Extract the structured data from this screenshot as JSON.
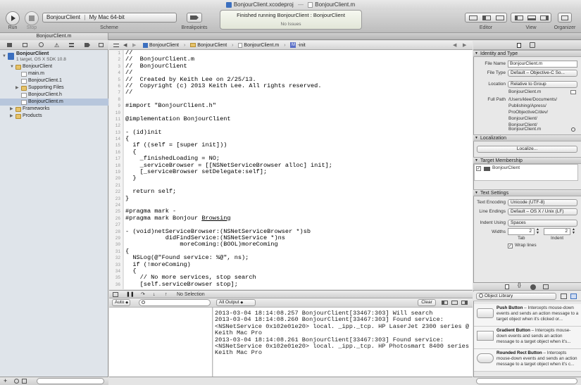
{
  "window": {
    "tabs": [
      "BonjourClient.xcodeproj",
      "BonjourClient.m"
    ]
  },
  "toolbar": {
    "run_label": "Run",
    "stop_label": "Stop",
    "scheme_target": "BonjourClient",
    "scheme_destination": "My Mac 64-bit",
    "scheme_label": "Scheme",
    "breakpoints_label": "Breakpoints",
    "activity_status": "Finished running BonjourClient : BonjourClient",
    "activity_issues": "No Issues",
    "editor_label": "Editor",
    "view_label": "View",
    "organizer_label": "Organizer"
  },
  "tab_title": "BonjourClient.m",
  "navigator": {
    "project_name": "BonjourClient",
    "project_sub": "1 target, OS X SDK 10.8",
    "items": [
      {
        "label": "BonjourClient"
      },
      {
        "label": "main.m"
      },
      {
        "label": "BonjourClient.1"
      },
      {
        "label": "Supporting Files"
      },
      {
        "label": "BonjourClient.h"
      },
      {
        "label": "BonjourClient.m"
      },
      {
        "label": "Frameworks"
      },
      {
        "label": "Products"
      }
    ]
  },
  "jumpbar": {
    "crumbs": [
      "BonjourClient",
      "BonjourClient",
      "BonjourClient.m",
      "-init"
    ]
  },
  "code": {
    "lines": [
      "//",
      "//  BonjourClient.m",
      "//  BonjourClient",
      "//",
      "//  Created by Keith Lee on 2/25/13.",
      "//  Copyright (c) 2013 Keith Lee. All rights reserved.",
      "//",
      "",
      "#import \"BonjourClient.h\"",
      "",
      "@implementation BonjourClient",
      "",
      "- (id)init",
      "{",
      "  if ((self = [super init]))",
      "  {",
      "    _finishedLoading = NO;",
      "    _serviceBrowser = [[NSNetServiceBrowser alloc] init];",
      "    [_serviceBrowser setDelegate:self];",
      "  }",
      "",
      "  return self;",
      "}",
      "",
      "#pragma mark -",
      "#pragma mark Bonjour ",
      "",
      "- (void)netServiceBrowser:(NSNetServiceBrowser *)sb",
      "           didFindService:(NSNetService *)ns",
      "               moreComing:(BOOL)moreComing",
      "{",
      "  NSLog(@\"Found service: %@\", ns);",
      "  if (!moreComing)",
      "  {",
      "    // No more services, stop search",
      "    [self.serviceBrowser stop];"
    ],
    "underlined_word": "Browsing",
    "line_numbers": [
      "1",
      "2",
      "3",
      "4",
      "5",
      "6",
      "7",
      "8",
      "9",
      "10",
      "11",
      "12",
      "13",
      "14",
      "15",
      "16",
      "17",
      "18",
      "19",
      "20",
      "21",
      "22",
      "23",
      "24",
      "25",
      "26",
      "27",
      "28",
      "29",
      "30",
      "31",
      "32",
      "33",
      "34",
      "35",
      "36"
    ]
  },
  "debug": {
    "selection": "No Selection",
    "auto_label": "Auto",
    "all_output_label": "All Output",
    "clear_label": "Clear",
    "console_lines": [
      "2013-03-04 18:14:08.257 BonjourClient[33467:303] Will search",
      "2013-03-04 18:14:08.260 BonjourClient[33467:303] Found service:",
      "<NSNetService 0x102e01e20> local. _ipp._tcp. HP LaserJet 2300 series @",
      "Keith Mac Pro",
      "2013-03-04 18:14:08.261 BonjourClient[33467:303] Found service:",
      "<NSNetService 0x102e01e20> local. _ipp._tcp. HP Photosmart 8400 series @",
      "Keith Mac Pro"
    ]
  },
  "inspector": {
    "identity_header": "Identity and Type",
    "file_name_label": "File Name",
    "file_name": "BonjourClient.m",
    "file_type_label": "File Type",
    "file_type": "Default – Objective-C So...",
    "location_label": "Location",
    "location": "Relative to Group",
    "location_file": "BonjourClient.m",
    "full_path_label": "Full Path",
    "full_path": [
      "/Users/klee/Documents/",
      "Publishing/Apress/",
      "ProObjectiveC/dev/",
      "BonjourClient/",
      "BonjourClient/",
      "BonjourClient.m"
    ],
    "localization_header": "Localization",
    "localize_button": "Localize...",
    "target_header": "Target Membership",
    "target_name": "BonjourClient",
    "text_settings_header": "Text Settings",
    "text_encoding_label": "Text Encoding",
    "text_encoding": "Unicode (UTF-8)",
    "line_endings_label": "Line Endings",
    "line_endings": "Default – OS X / Unix (LF)",
    "indent_using_label": "Indent Using",
    "indent_using": "Spaces",
    "widths_label": "Widths",
    "tab_width": "2",
    "indent_width": "2",
    "tab_label": "Tab",
    "indent_label": "Indent",
    "wrap_lines_label": "Wrap lines",
    "library_selector": "Object Library",
    "library_items": [
      {
        "title": "Push Button",
        "desc": " – Intercepts mouse-down events and sends an action message to a target object when it's clicked or..."
      },
      {
        "title": "Gradient Button",
        "desc": " – Intercepts mouse-down events and sends an action message to a target object when it's..."
      },
      {
        "title": "Rounded Rect Button",
        "desc": " – Intercepts mouse-down events and sends an action message to a target object when it's c..."
      }
    ]
  }
}
